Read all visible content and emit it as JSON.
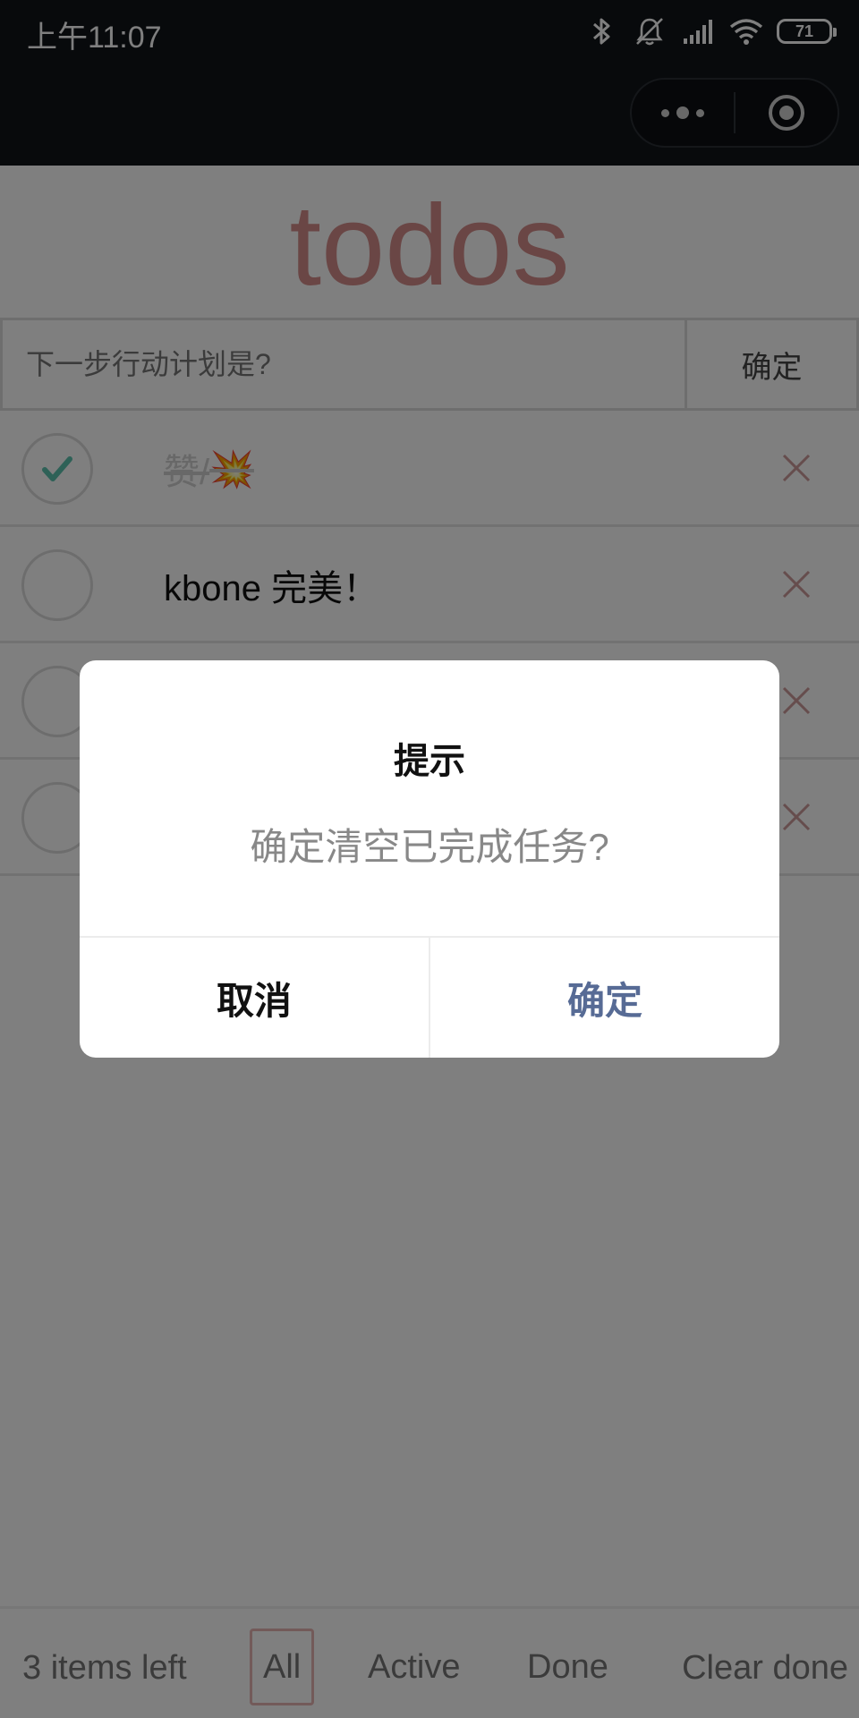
{
  "status_bar": {
    "time": "上午11:07",
    "battery": "71",
    "icons": [
      "bluetooth-icon",
      "bell-off-icon",
      "signal-icon",
      "wifi-icon",
      "battery-icon"
    ]
  },
  "nav": {
    "capsule": [
      "more-icon",
      "target-icon"
    ]
  },
  "app": {
    "title": "todos",
    "title_color": "#d48d8a",
    "new_todo": {
      "placeholder": "下一步行动计划是?",
      "value": "",
      "confirm_label": "确定"
    },
    "todos": [
      {
        "text": "赞/",
        "emoji": "💥",
        "completed": true
      },
      {
        "text": "kbone 完美！",
        "emoji": "",
        "completed": false
      },
      {
        "text": "",
        "emoji": "",
        "completed": false
      },
      {
        "text": "",
        "emoji": "",
        "completed": false
      }
    ],
    "footer": {
      "items_left": "3 items left",
      "filters": [
        "All",
        "Active",
        "Done"
      ],
      "selected_filter": "All",
      "clear_label": "Clear done"
    }
  },
  "modal": {
    "title": "提示",
    "content": "确定清空已完成任务?",
    "cancel_label": "取消",
    "confirm_label": "确定",
    "confirm_color": "#576b95"
  }
}
